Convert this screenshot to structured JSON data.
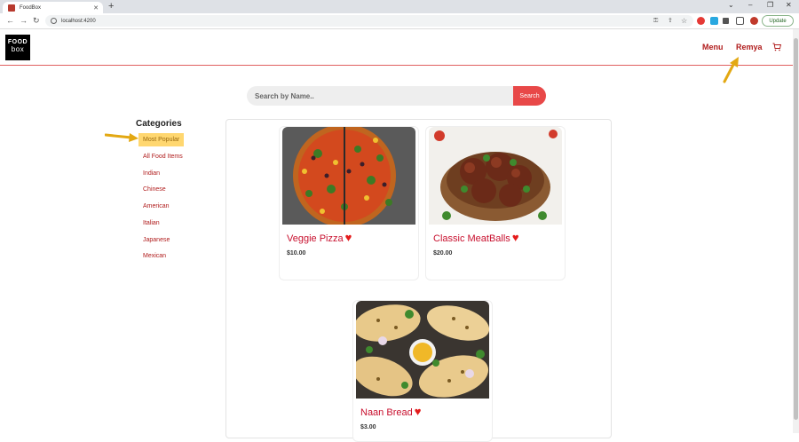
{
  "browser": {
    "tab_title": "FoodBox",
    "url": "localhost:4200",
    "update_label": "Update"
  },
  "header": {
    "logo_top": "FOOD",
    "logo_bottom": "box",
    "menu_label": "Menu",
    "user_label": "Remya"
  },
  "search": {
    "placeholder": "Search by Name..",
    "button_label": "Search"
  },
  "categories": {
    "title": "Categories",
    "items": [
      "Most Popular",
      "All Food Items",
      "Indian",
      "Chinese",
      "American",
      "Italian",
      "Japanese",
      "Mexican"
    ],
    "active": "Most Popular"
  },
  "products": [
    {
      "name": "Veggie Pizza",
      "price": "$10.00"
    },
    {
      "name": "Classic MeatBalls",
      "price": "$20.00"
    },
    {
      "name": "Naan Bread",
      "price": "$3.00"
    }
  ],
  "colors": {
    "accent": "#e84848",
    "link": "#b01c1c",
    "active_category": "#ffd770",
    "heart": "#e41b1b"
  }
}
